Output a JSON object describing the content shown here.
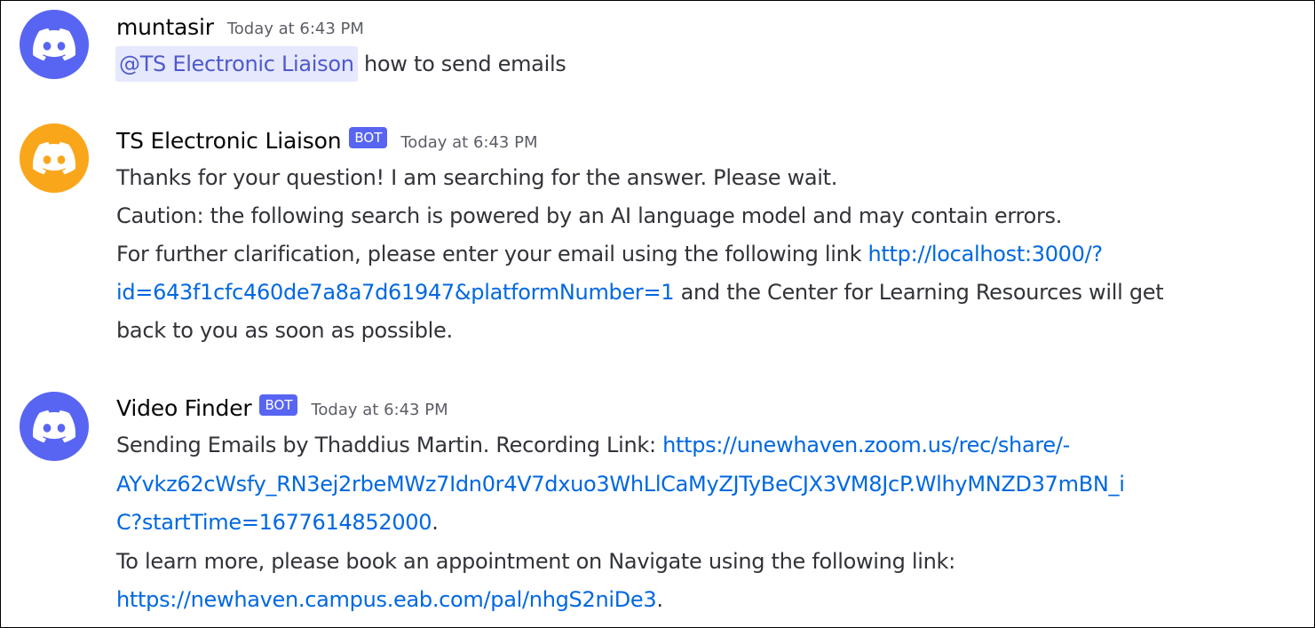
{
  "messages": [
    {
      "username": "muntasir",
      "timestamp": "Today at 6:43 PM",
      "avatar_color": "#5865f2",
      "mention": "@TS Electronic Liaison",
      "text": " how to send emails"
    },
    {
      "username": "TS Electronic Liaison",
      "bot_label": "BOT",
      "timestamp": "Today at 6:43 PM",
      "avatar_color": "#faa61a",
      "line1": "Thanks for your question! I am searching for the answer. Please wait.",
      "line2": "Caution: the following search is powered by an AI language model and may contain errors.",
      "line3_text": "For further clarification, please enter your email using the following link ",
      "line3_link": "http://localhost:3000/?",
      "line4_link": "id=643f1cfc460de7a8a7d61947&platformNumber=1",
      "line4_text": " and the Center for Learning Resources will get",
      "line5": "back to you as soon as possible."
    },
    {
      "username": "Video Finder",
      "bot_label": "BOT",
      "timestamp": "Today at 6:43 PM",
      "avatar_color": "#5865f2",
      "line1_text": "Sending Emails by Thaddius Martin. Recording Link: ",
      "line1_link": "https://unewhaven.zoom.us/rec/share/-",
      "line2_link": "AYvkz62cWsfy_RN3ej2rbeMWz7Idn0r4V7dxuo3WhLlCaMyZJTyBeCJX3VM8JcP.WlhyMNZD37mBN_i",
      "line3_link": "C?startTime=1677614852000",
      "line3_text": ".",
      "line4": "To learn more, please book an appointment on Navigate using the following link:",
      "line5_link": "https://newhaven.campus.eab.com/pal/nhgS2niDe3",
      "line5_text": "."
    }
  ]
}
